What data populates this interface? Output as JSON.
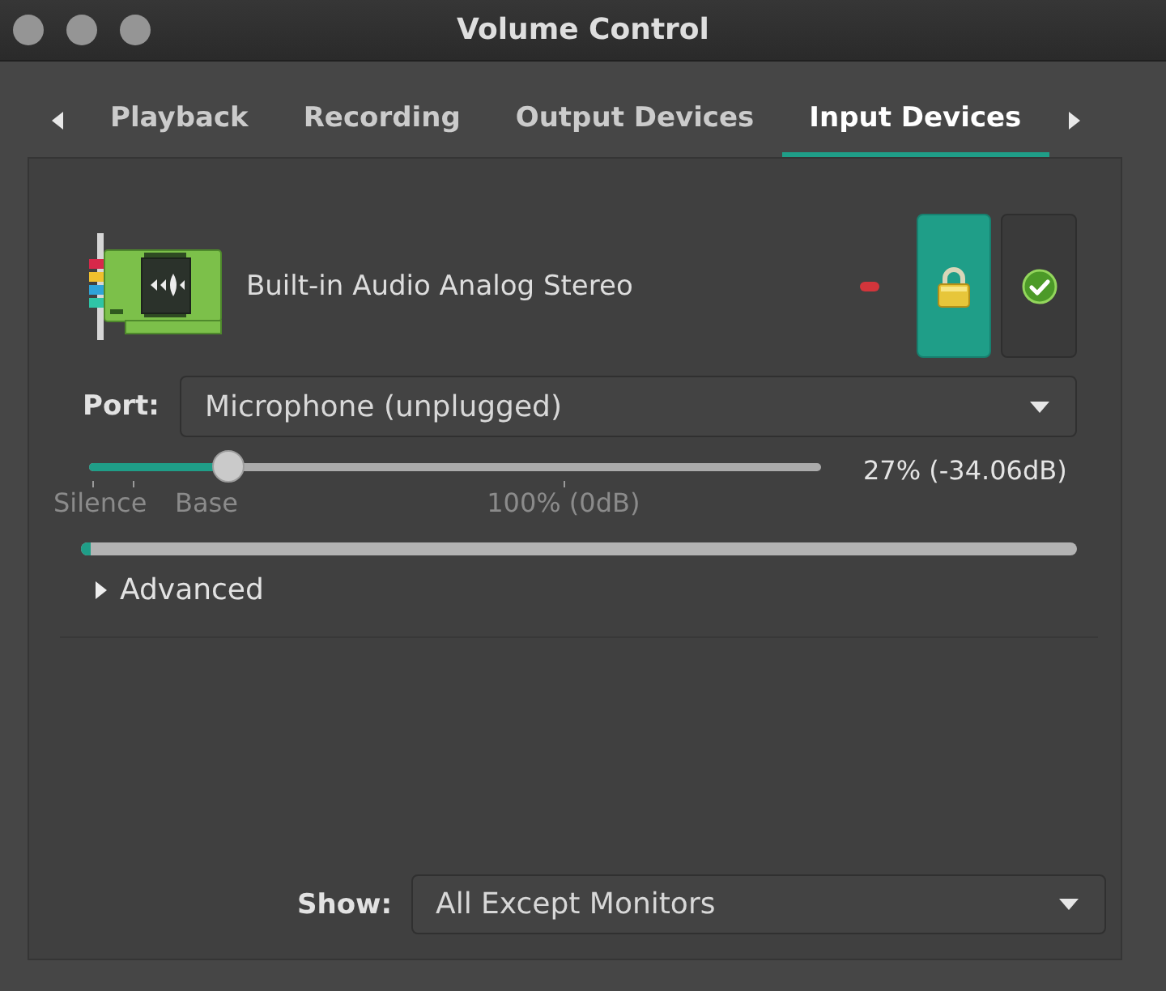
{
  "window": {
    "title": "Volume Control"
  },
  "tabs": [
    {
      "label": "Playback",
      "selected": false
    },
    {
      "label": "Recording",
      "selected": false
    },
    {
      "label": "Output Devices",
      "selected": false
    },
    {
      "label": "Input Devices",
      "selected": true
    }
  ],
  "device": {
    "name": "Built-in Audio Analog Stereo",
    "muted": false,
    "locked": true,
    "fallback": false,
    "port": {
      "label": "Port:",
      "value": "Microphone (unplugged)"
    },
    "volume": {
      "level": 0.19,
      "reading": "27% (-34.06dB)",
      "marks": [
        {
          "label": "Silence"
        },
        {
          "label": "Base"
        },
        {
          "label": "100% (0dB)"
        }
      ]
    },
    "peak_meter": {
      "level": 0.01
    },
    "advanced": {
      "label": "Advanced",
      "expanded": false
    }
  },
  "filter": {
    "label": "Show:",
    "value": "All Except Monitors"
  }
}
